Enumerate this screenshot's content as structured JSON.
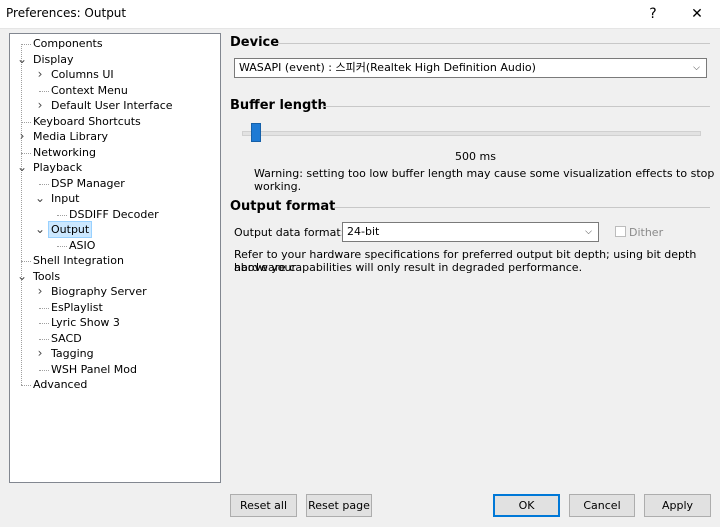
{
  "window": {
    "title": "Preferences: Output"
  },
  "titlebar": {
    "help": "?",
    "close": "✕"
  },
  "tree": [
    {
      "label": "Components",
      "level": 0,
      "exp": ""
    },
    {
      "label": "Display",
      "level": 0,
      "exp": "open"
    },
    {
      "label": "Columns UI",
      "level": 1,
      "exp": "closed"
    },
    {
      "label": "Context Menu",
      "level": 1,
      "exp": ""
    },
    {
      "label": "Default User Interface",
      "level": 1,
      "exp": "closed"
    },
    {
      "label": "Keyboard Shortcuts",
      "level": 0,
      "exp": ""
    },
    {
      "label": "Media Library",
      "level": 0,
      "exp": "closed"
    },
    {
      "label": "Networking",
      "level": 0,
      "exp": ""
    },
    {
      "label": "Playback",
      "level": 0,
      "exp": "open"
    },
    {
      "label": "DSP Manager",
      "level": 1,
      "exp": ""
    },
    {
      "label": "Input",
      "level": 1,
      "exp": "open"
    },
    {
      "label": "DSDIFF Decoder",
      "level": 2,
      "exp": ""
    },
    {
      "label": "Output",
      "level": 1,
      "exp": "open",
      "selected": true
    },
    {
      "label": "ASIO",
      "level": 2,
      "exp": ""
    },
    {
      "label": "Shell Integration",
      "level": 0,
      "exp": ""
    },
    {
      "label": "Tools",
      "level": 0,
      "exp": "open"
    },
    {
      "label": "Biography Server",
      "level": 1,
      "exp": "closed"
    },
    {
      "label": "EsPlaylist",
      "level": 1,
      "exp": ""
    },
    {
      "label": "Lyric Show 3",
      "level": 1,
      "exp": ""
    },
    {
      "label": "SACD",
      "level": 1,
      "exp": ""
    },
    {
      "label": "Tagging",
      "level": 1,
      "exp": "closed"
    },
    {
      "label": "WSH Panel Mod",
      "level": 1,
      "exp": ""
    },
    {
      "label": "Advanced",
      "level": 0,
      "exp": ""
    }
  ],
  "device": {
    "heading": "Device",
    "selected": "WASAPI (event) : 스피커(Realtek High Definition Audio)"
  },
  "buffer": {
    "heading": "Buffer length",
    "value_label": "500 ms",
    "slider_fraction": 0.02,
    "warning": "Warning: setting too low buffer length may cause some visualization effects to stop working."
  },
  "output_format": {
    "heading": "Output format",
    "format_label": "Output data format:",
    "format_value": "24-bit",
    "dither_label": "Dither",
    "dither_checked": false,
    "note_line1": "Refer to your hardware specifications for preferred output bit depth; using bit depth above your",
    "note_line2": "hardware capabilities will only result in degraded performance."
  },
  "buttons": {
    "reset_all": "Reset all",
    "reset_page": "Reset page",
    "ok": "OK",
    "cancel": "Cancel",
    "apply": "Apply"
  },
  "colors": {
    "accent": "#0078d7",
    "slider": "#1e7ad4",
    "selection": "#cce8ff"
  }
}
